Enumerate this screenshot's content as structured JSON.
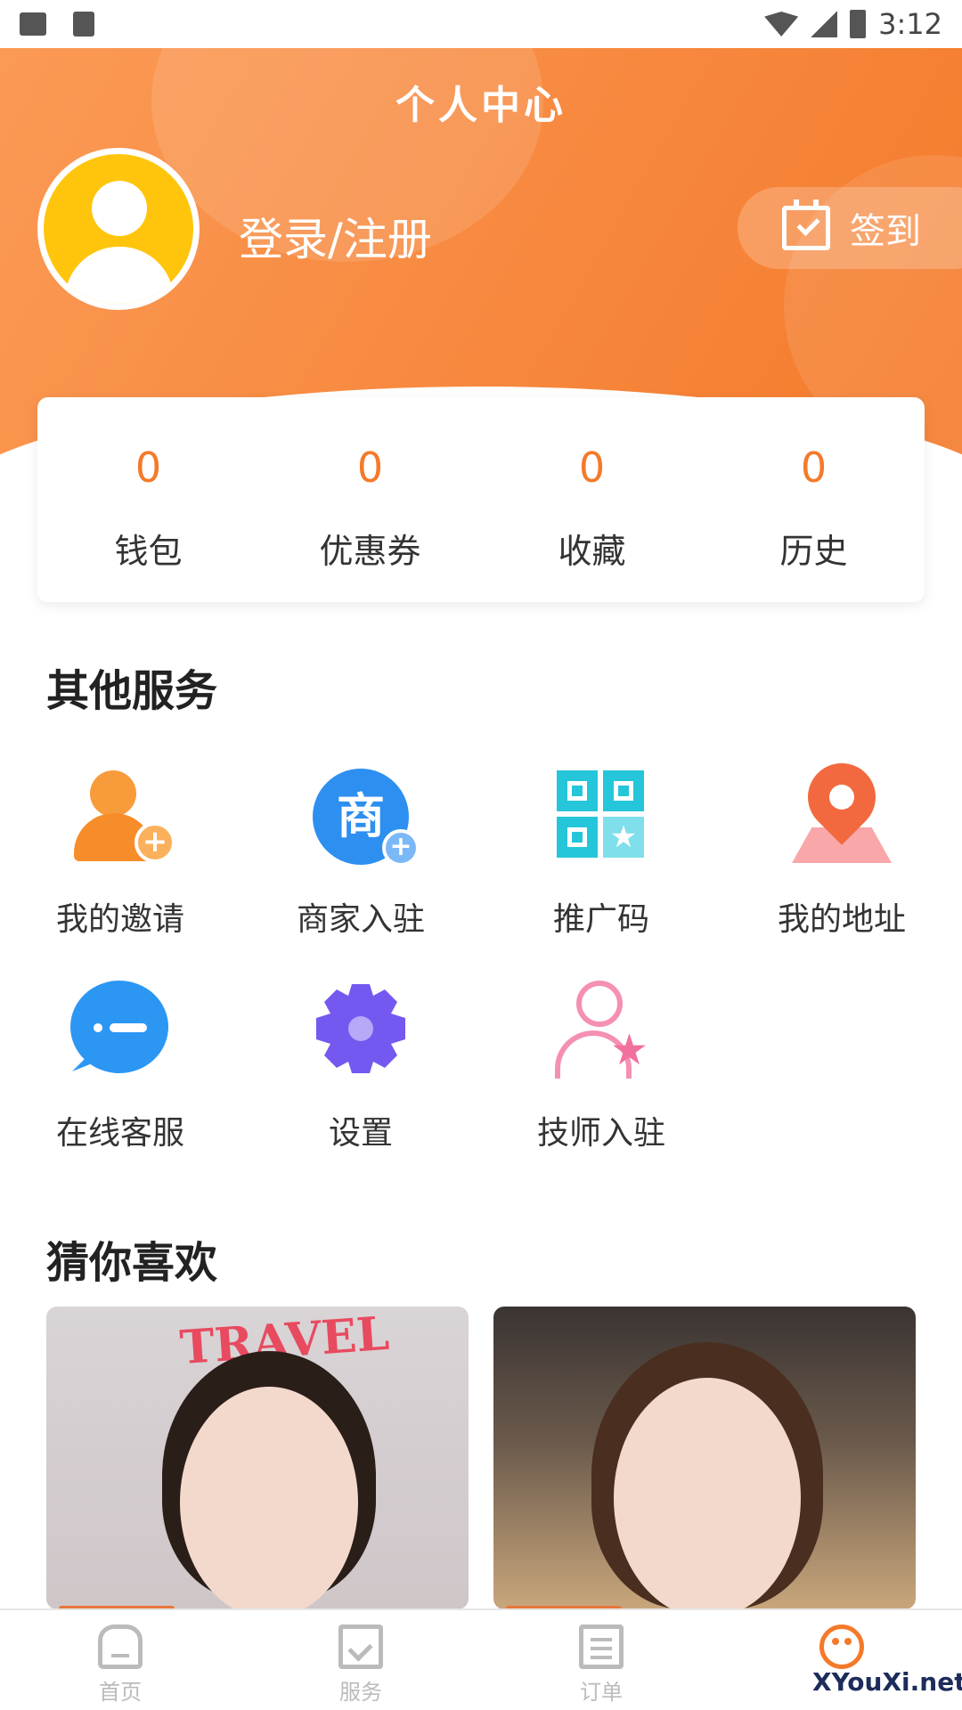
{
  "status_bar": {
    "time": "3:12"
  },
  "header": {
    "title": "个人中心",
    "login_label": "登录/注册",
    "checkin_label": "签到"
  },
  "stats": [
    {
      "value": "0",
      "label": "钱包"
    },
    {
      "value": "0",
      "label": "优惠券"
    },
    {
      "value": "0",
      "label": "收藏"
    },
    {
      "value": "0",
      "label": "历史"
    }
  ],
  "services_section": {
    "title": "其他服务",
    "items": [
      {
        "label": "我的邀请",
        "icon": "user-plus-icon"
      },
      {
        "label": "商家入驻",
        "icon": "shop-plus-icon"
      },
      {
        "label": "推广码",
        "icon": "qr-code-icon"
      },
      {
        "label": "我的地址",
        "icon": "location-pin-icon"
      },
      {
        "label": "在线客服",
        "icon": "chat-icon"
      },
      {
        "label": "设置",
        "icon": "gear-icon"
      },
      {
        "label": "技师入驻",
        "icon": "user-star-icon"
      }
    ]
  },
  "recommend_section": {
    "title": "猜你喜欢",
    "card1_text": "TRAVEL"
  },
  "tabbar": [
    {
      "label": "首页",
      "icon": "home-icon"
    },
    {
      "label": "服务",
      "icon": "bookmark-icon"
    },
    {
      "label": "订单",
      "icon": "order-icon"
    },
    {
      "label": "",
      "icon": "profile-icon"
    }
  ],
  "watermark": "XYouXi.net",
  "colors": {
    "accent": "#f47a2a",
    "avatar": "#ffc50c"
  }
}
